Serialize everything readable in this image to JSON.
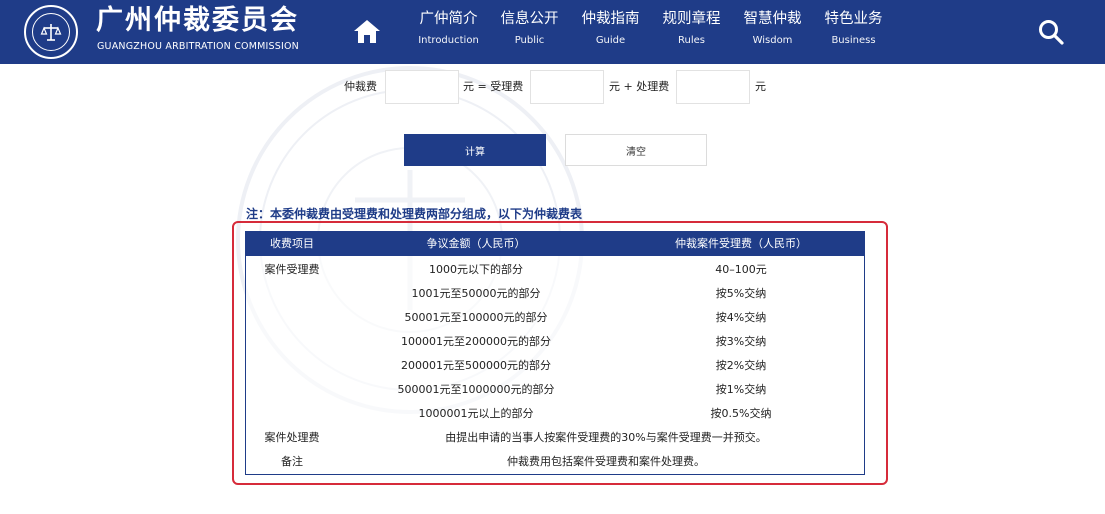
{
  "header": {
    "logo_seal_text": "广州仲裁委员会",
    "title": "广州仲裁委员会",
    "subtitle": "GUANGZHOU ARBITRATION COMMISSION",
    "home_icon": "home-icon",
    "search_icon": "search-icon",
    "nav": [
      {
        "cn": "广仲简介",
        "en": "Introduction"
      },
      {
        "cn": "信息公开",
        "en": "Public"
      },
      {
        "cn": "仲裁指南",
        "en": "Guide"
      },
      {
        "cn": "规则章程",
        "en": "Rules"
      },
      {
        "cn": "智慧仲裁",
        "en": "Wisdom"
      },
      {
        "cn": "特色业务",
        "en": "Business"
      }
    ]
  },
  "calculator": {
    "label_fee": "仲裁费",
    "unit_eq_accept": "元 = 受理费",
    "unit_plus_handle": "元 + 处理费",
    "unit_end": "元",
    "fee_value": "",
    "accept_value": "",
    "handle_value": "",
    "calc_label": "计算",
    "clear_label": "清空"
  },
  "note": "注：本委仲裁费由受理费和处理费两部分组成，以下为仲裁费表",
  "table": {
    "headers": [
      "收费项目",
      "争议金额（人民币）",
      "仲裁案件受理费（人民币）"
    ],
    "rows": [
      [
        "案件受理费",
        "1000元以下的部分",
        "40–100元"
      ],
      [
        "",
        "1001元至50000元的部分",
        "按5%交纳"
      ],
      [
        "",
        "50001元至100000元的部分",
        "按4%交纳"
      ],
      [
        "",
        "100001元至200000元的部分",
        "按3%交纳"
      ],
      [
        "",
        "200001元至500000元的部分",
        "按2%交纳"
      ],
      [
        "",
        "500001元至1000000元的部分",
        "按1%交纳"
      ],
      [
        "",
        "1000001元以上的部分",
        "按0.5%交纳"
      ]
    ],
    "processing": {
      "label": "案件处理费",
      "text": "由提出申请的当事人按案件受理费的30%与案件受理费一并预交。"
    },
    "remark": {
      "label": "备注",
      "text": "仲裁费用包括案件受理费和案件处理费。"
    }
  },
  "colors": {
    "brand": "#1f3c88",
    "highlight": "#d62b3a"
  }
}
